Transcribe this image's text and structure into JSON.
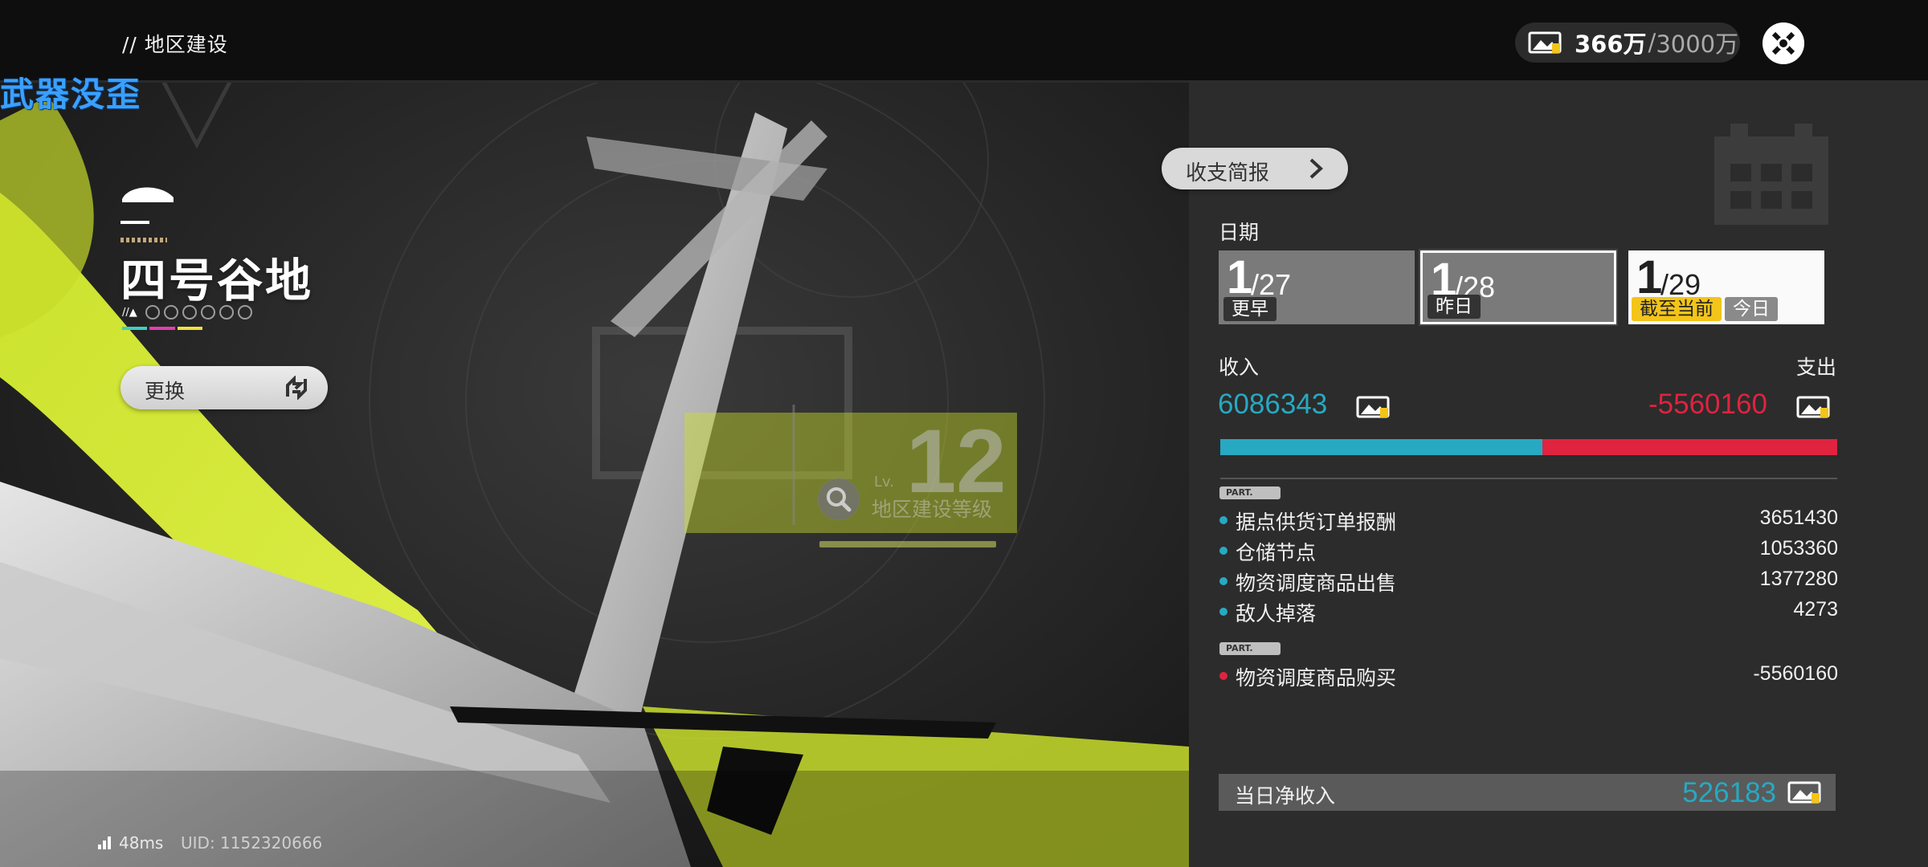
{
  "breadcrumb": "// 地区建设",
  "watermark": "武器没歪",
  "region": {
    "name": "四号谷地",
    "rank_mark": "//▲",
    "switch_label": "更换"
  },
  "level": {
    "value": "12",
    "lv_label": "Lv.",
    "label": "地区建设等级"
  },
  "status": {
    "ping": "48ms",
    "uid": "UID: 1152320666"
  },
  "currency": {
    "current": "366万",
    "separator": "/",
    "max": "3000万",
    "icon": "currency-icon"
  },
  "report": {
    "tab_label": "收支简报",
    "date_heading": "日期",
    "dates": [
      {
        "big": "1",
        "small": "/27",
        "tag": "更早"
      },
      {
        "big": "1",
        "small": "/28",
        "tag": "昨日"
      },
      {
        "big": "1",
        "small": "/29",
        "tag": "截至当前",
        "tag2": "今日"
      }
    ],
    "income_heading": "收入",
    "expense_heading": "支出",
    "income_total": "6086343",
    "expense_total": "-5560160",
    "income_share": 0.5226,
    "part_badge": "PART.",
    "income_items": [
      {
        "name": "据点供货订单报酬",
        "value": "3651430"
      },
      {
        "name": "仓储节点",
        "value": "1053360"
      },
      {
        "name": "物资调度商品出售",
        "value": "1377280"
      },
      {
        "name": "敌人掉落",
        "value": "4273"
      }
    ],
    "expense_items": [
      {
        "name": "物资调度商品购买",
        "value": "-5560160"
      }
    ],
    "net_label": "当日净收入",
    "net_value": "526183"
  },
  "colors": {
    "income": "#27a9c1",
    "expense": "#e0233f",
    "accent_yellow": "#f3c419",
    "lime": "#d6ee3a"
  }
}
